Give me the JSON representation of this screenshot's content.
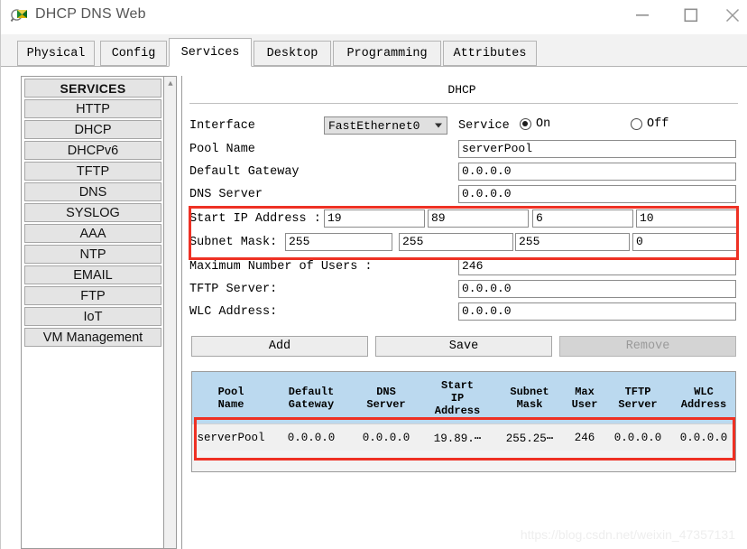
{
  "window": {
    "title": "DHCP DNS Web",
    "icon": "magnifier-package-icon",
    "minimize_label": "Minimize",
    "maximize_label": "Maximize",
    "close_label": "Close"
  },
  "tabs": [
    {
      "label": "Physical",
      "active": false
    },
    {
      "label": "Config",
      "active": false
    },
    {
      "label": "Services",
      "active": true
    },
    {
      "label": "Desktop",
      "active": false
    },
    {
      "label": "Programming",
      "active": false
    },
    {
      "label": "Attributes",
      "active": false
    }
  ],
  "sidebar": {
    "header": "SERVICES",
    "items": [
      {
        "label": "HTTP"
      },
      {
        "label": "DHCP"
      },
      {
        "label": "DHCPv6"
      },
      {
        "label": "TFTP"
      },
      {
        "label": "DNS"
      },
      {
        "label": "SYSLOG"
      },
      {
        "label": "AAA"
      },
      {
        "label": "NTP"
      },
      {
        "label": "EMAIL"
      },
      {
        "label": "FTP"
      },
      {
        "label": "IoT"
      },
      {
        "label": "VM Management"
      }
    ],
    "scroll_up_icon": "chevron-up-icon"
  },
  "panel": {
    "title": "DHCP",
    "interface": {
      "label": "Interface",
      "value": "FastEthernet0",
      "dropdown_icon": "chevron-down-icon"
    },
    "service": {
      "label": "Service",
      "on_label": "On",
      "off_label": "Off",
      "selected": "On"
    },
    "pool_name": {
      "label": "Pool Name",
      "value": "serverPool"
    },
    "default_gateway": {
      "label": "Default Gateway",
      "value": "0.0.0.0"
    },
    "dns_server": {
      "label": "DNS Server",
      "value": "0.0.0.0"
    },
    "start_ip": {
      "label": "Start IP Address :",
      "octets": [
        "19",
        "89",
        "6",
        "10"
      ]
    },
    "subnet_mask": {
      "label": "Subnet Mask:",
      "octets": [
        "255",
        "255",
        "255",
        "0"
      ]
    },
    "max_users": {
      "label": "Maximum Number of Users :",
      "value": "246"
    },
    "tftp_server": {
      "label": "TFTP Server:",
      "value": "0.0.0.0"
    },
    "wlc_address": {
      "label": "WLC Address:",
      "value": "0.0.0.0"
    },
    "buttons": {
      "add": "Add",
      "save": "Save",
      "remove": "Remove"
    }
  },
  "table": {
    "columns": [
      "Pool\nName",
      "Default\nGateway",
      "DNS\nServer",
      "Start\nIP\nAddress",
      "Subnet\nMask",
      "Max\nUser",
      "TFTP\nServer",
      "WLC\nAddress"
    ],
    "rows": [
      [
        "serverPool",
        "0.0.0.0",
        "0.0.0.0",
        "19.89.⋯",
        "255.25⋯",
        "246",
        "0.0.0.0",
        "0.0.0.0"
      ]
    ]
  },
  "annotations": {
    "highlight_color": "#ee3124",
    "boxes": [
      {
        "name": "ip-range-highlight"
      },
      {
        "name": "pool-row-highlight"
      }
    ]
  },
  "watermark": {
    "text": "https://blog.csdn.net/weixin_47357131"
  },
  "colors": {
    "table_header_blue": "#bbd9ef",
    "panel_bg": "#ffffff",
    "button_face": "#ededed"
  }
}
